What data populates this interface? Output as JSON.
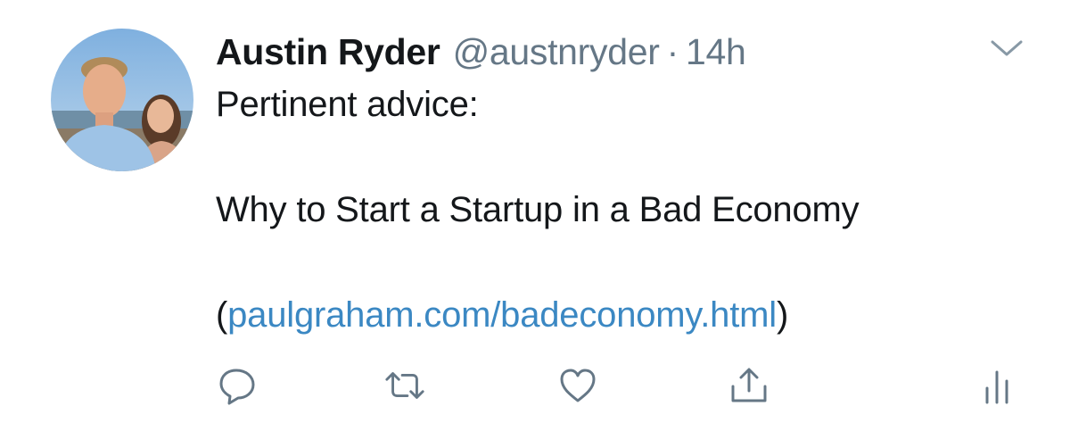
{
  "tweet": {
    "author": {
      "display_name": "Austin Ryder",
      "handle": "@austnryder",
      "separator": "·",
      "timestamp": "14h",
      "avatar_icon": "profile-photo"
    },
    "text": {
      "line1": "Pertinent advice:",
      "line2": "Why to Start a Startup in a Bad Economy",
      "link_open_paren": "(",
      "link_text": "paulgraham.com/badeconomy.html",
      "link_close_paren": ")"
    },
    "menu_icon": "chevron-down-icon",
    "actions": [
      {
        "name": "reply",
        "icon": "reply-icon"
      },
      {
        "name": "retweet",
        "icon": "retweet-icon"
      },
      {
        "name": "like",
        "icon": "heart-icon"
      },
      {
        "name": "share",
        "icon": "share-icon"
      },
      {
        "name": "analytics",
        "icon": "analytics-icon"
      }
    ]
  },
  "colors": {
    "text_primary": "#14171a",
    "text_secondary": "#657786",
    "link": "#3b88c3",
    "icon": "#657786"
  }
}
